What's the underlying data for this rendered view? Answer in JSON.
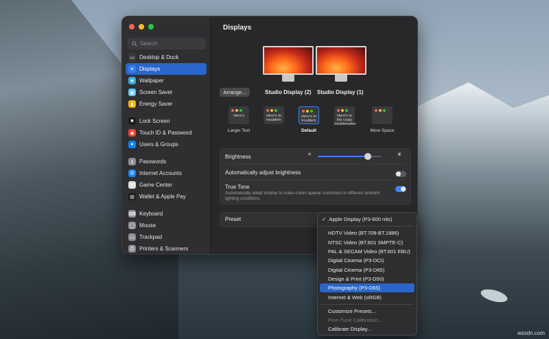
{
  "window": {
    "title": "Displays"
  },
  "search": {
    "placeholder": "Search"
  },
  "sidebar": {
    "groups": [
      [
        {
          "label": "Desktop & Dock",
          "icon": "dock-icon",
          "color": "#3a3a3c"
        },
        {
          "label": "Displays",
          "icon": "sun-icon",
          "color": "#2f7bf6",
          "selected": true
        },
        {
          "label": "Wallpaper",
          "icon": "wallpaper-icon",
          "color": "#34aadc"
        },
        {
          "label": "Screen Saver",
          "icon": "screen-saver-icon",
          "color": "#5ac8fa"
        },
        {
          "label": "Energy Saver",
          "icon": "battery-icon",
          "color": "#f0b400"
        }
      ],
      [
        {
          "label": "Lock Screen",
          "icon": "lock-icon",
          "color": "#1c1c1e"
        },
        {
          "label": "Touch ID & Password",
          "icon": "fingerprint-icon",
          "color": "#ff3b30"
        },
        {
          "label": "Users & Groups",
          "icon": "users-icon",
          "color": "#0a84ff"
        }
      ],
      [
        {
          "label": "Passwords",
          "icon": "key-icon",
          "color": "#8e8e93"
        },
        {
          "label": "Internet Accounts",
          "icon": "at-icon",
          "color": "#0a84ff"
        },
        {
          "label": "Game Center",
          "icon": "game-center-icon",
          "color": "#e0e0e0"
        },
        {
          "label": "Wallet & Apple Pay",
          "icon": "wallet-icon",
          "color": "#1c1c1e"
        }
      ],
      [
        {
          "label": "Keyboard",
          "icon": "keyboard-icon",
          "color": "#8e8e93"
        },
        {
          "label": "Mouse",
          "icon": "mouse-icon",
          "color": "#8e8e93"
        },
        {
          "label": "Trackpad",
          "icon": "trackpad-icon",
          "color": "#8e8e93"
        },
        {
          "label": "Printers & Scanners",
          "icon": "printer-icon",
          "color": "#8e8e93"
        }
      ]
    ]
  },
  "displays": {
    "arrange_label": "Arrange...",
    "monitor_left": "Studio Display (2)",
    "monitor_right": "Studio Display (1)"
  },
  "resolution": {
    "options": [
      {
        "label": "Larger Text",
        "thumb_text": "Here's",
        "selected": false
      },
      {
        "label": "",
        "thumb_text": "Here's to troublem",
        "selected": false
      },
      {
        "label": "Default",
        "thumb_text": "Here's to troublem",
        "selected": true
      },
      {
        "label": "",
        "thumb_text": "Here's to the crazy troublemaker",
        "selected": false
      },
      {
        "label": "More Space",
        "thumb_text": "",
        "selected": false
      }
    ]
  },
  "settings": {
    "brightness_label": "Brightness",
    "brightness_level": 0.78,
    "auto_brightness_label": "Automatically adjust brightness",
    "auto_brightness_on": false,
    "true_tone_label": "True Tone",
    "true_tone_desc": "Automatically adapt display to make colors appear consistent in different ambient lighting conditions.",
    "true_tone_on": true,
    "preset_label": "Preset"
  },
  "dropdown": {
    "checked": "Apple Display (P3-600 nits)",
    "items": [
      "HDTV Video (BT.709-BT.1886)",
      "NTSC Video (BT.601 SMPTE-C)",
      "PAL & SECAM Video (BT.601 EBU)",
      "Digital Cinema (P3-DCI)",
      "Digital Cinema (P3-D65)",
      "Design & Print (P3-D50)",
      "Photography (P3-D65)",
      "Internet & Web (sRGB)"
    ],
    "highlighted": "Photography (P3-D65)",
    "footer": [
      {
        "label": "Customize Presets...",
        "disabled": false
      },
      {
        "label": "Fine-Tune Calibration...",
        "disabled": true
      },
      {
        "label": "Calibrate Display...",
        "disabled": false
      }
    ]
  },
  "watermark": "wsxdn.com",
  "colors": {
    "accent": "#2a66c9",
    "toggle_on": "#3b82f6",
    "toggle_off": "#5a5a5e"
  }
}
